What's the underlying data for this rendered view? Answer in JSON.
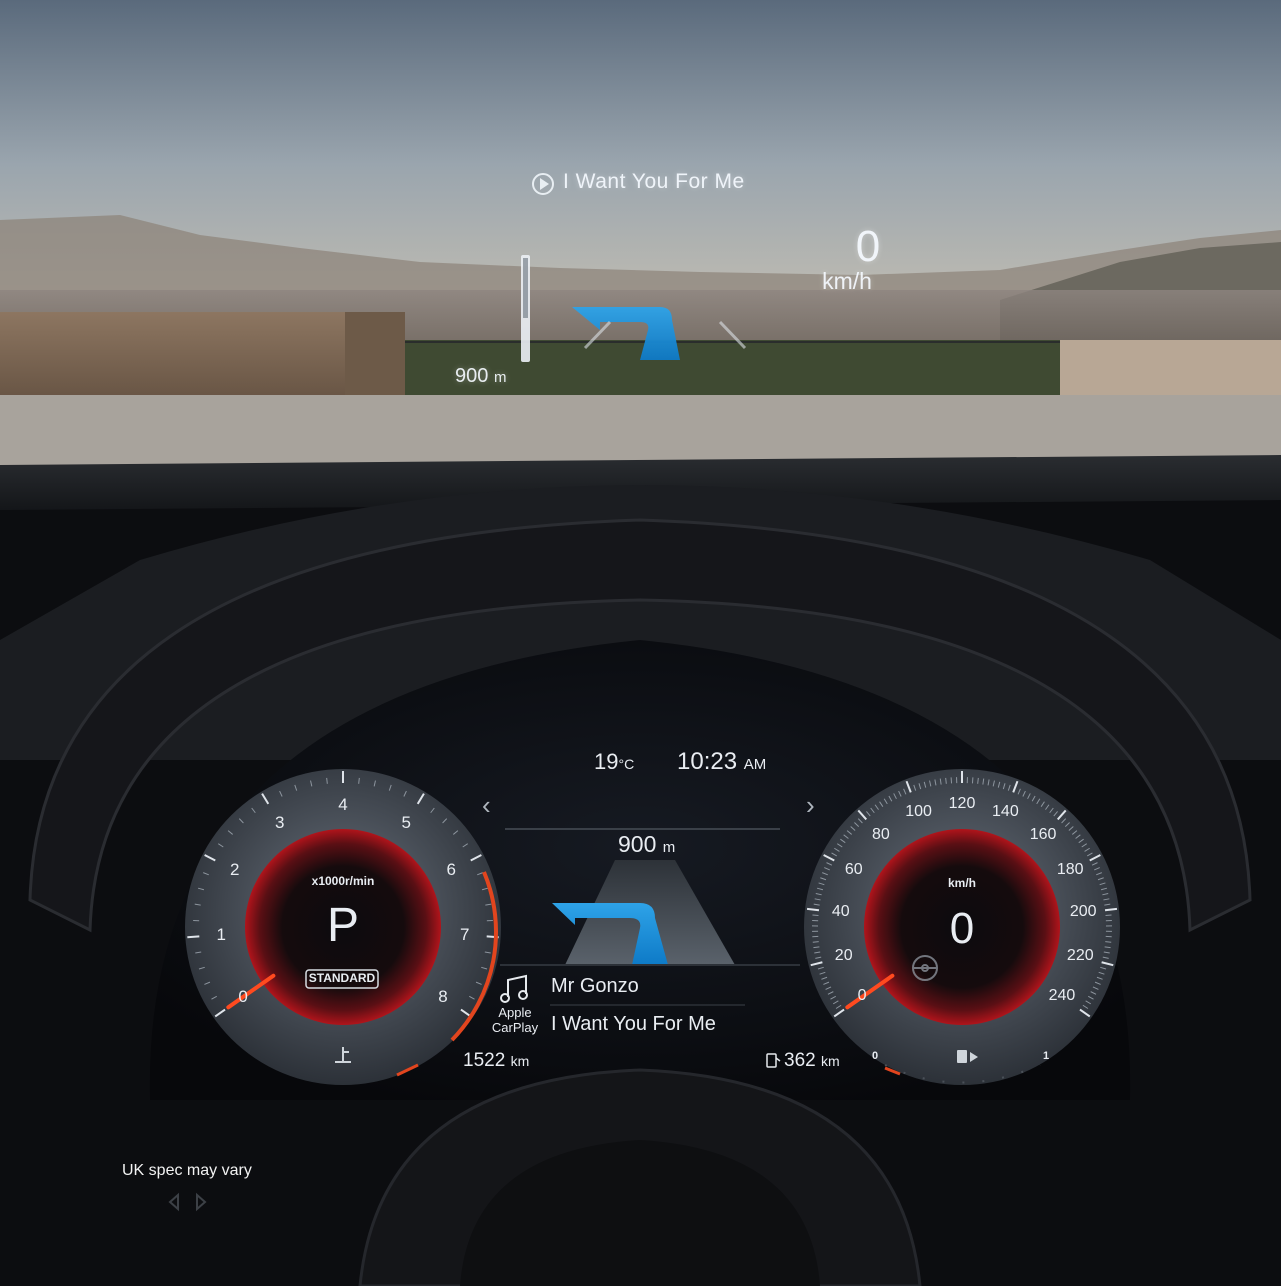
{
  "hud": {
    "media_track": "I Want You For Me",
    "speed_value": "0",
    "speed_unit": "km/h",
    "nav_distance_value": "900",
    "nav_distance_unit": "m"
  },
  "cluster": {
    "temperature_value": "19",
    "temperature_unit": "°C",
    "clock_time": "10:23",
    "clock_ampm": "AM",
    "nav_distance_value": "900",
    "nav_distance_unit": "m",
    "prev_arrow": "‹",
    "next_arrow": "›",
    "tachometer": {
      "unit_label": "x1000r/min",
      "gear": "P",
      "drive_mode": "STANDARD",
      "scale_labels": [
        "0",
        "1",
        "2",
        "3",
        "4",
        "5",
        "6",
        "7",
        "8"
      ],
      "value": 0
    },
    "speedometer": {
      "unit_label": "km/h",
      "speed": "0",
      "scale_labels": [
        "0",
        "20",
        "40",
        "60",
        "80",
        "100",
        "120",
        "140",
        "160",
        "180",
        "200",
        "220",
        "240"
      ],
      "value": 0
    },
    "media": {
      "source_line1": "Apple",
      "source_line2": "CarPlay",
      "artist": "Mr Gonzo",
      "track": "I Want You For Me"
    },
    "odometer": {
      "value": "1522",
      "unit": "km"
    },
    "range": {
      "value": "362",
      "unit": "km"
    },
    "fuel_gauge": {
      "empty_label": "0",
      "full_label": "1"
    },
    "icons": [
      "music-note-icon",
      "coolant-temp-icon",
      "steering-assist-icon",
      "fuel-pump-icon",
      "play-circle-icon",
      "turn-signal-icon"
    ]
  },
  "footer": {
    "disclaimer": "UK spec may vary"
  }
}
